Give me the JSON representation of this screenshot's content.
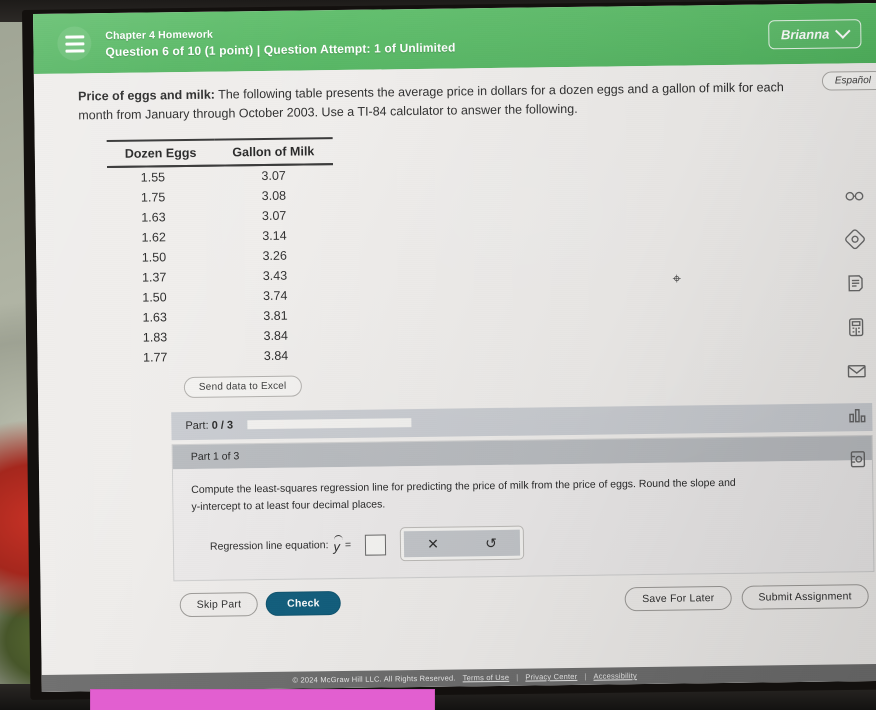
{
  "header": {
    "menu_icon": "hamburger-menu-icon",
    "assignment_title": "Chapter 4 Homework",
    "question_status": "Question 6 of 10 (1 point)  |  Question Attempt: 1 of Unlimited",
    "user_name": "Brianna",
    "user_chevron_icon": "chevron-down-icon",
    "brand_green": "#55b862"
  },
  "language_toggle": {
    "label": "Español"
  },
  "prompt": {
    "bold_lead": "Price of eggs and milk:",
    "rest": " The following table presents the average price in dollars for a dozen eggs and a gallon of milk for each month from January through October 2003. Use a TI-84 calculator to answer the following."
  },
  "table": {
    "columns": [
      "Dozen Eggs",
      "Gallon of Milk"
    ],
    "rows": [
      [
        "1.55",
        "3.07"
      ],
      [
        "1.75",
        "3.08"
      ],
      [
        "1.63",
        "3.07"
      ],
      [
        "1.62",
        "3.14"
      ],
      [
        "1.50",
        "3.26"
      ],
      [
        "1.37",
        "3.43"
      ],
      [
        "1.50",
        "3.74"
      ],
      [
        "1.63",
        "3.81"
      ],
      [
        "1.83",
        "3.84"
      ],
      [
        "1.77",
        "3.84"
      ]
    ]
  },
  "excel_button": {
    "label": "Send data to Excel"
  },
  "part_progress": {
    "label_prefix": "Part:",
    "score": "0 / 3",
    "progress_percent": 0
  },
  "part_card": {
    "header": "Part 1 of 3",
    "question_line1": "Compute the least-squares regression line for predicting the price of milk from the price of eggs. Round the slope and",
    "question_line2": "y-intercept to at least four decimal places.",
    "equation_label": "Regression line equation:",
    "equation_symbol": "y",
    "equation_operator": "=",
    "answer_value": "",
    "math_tools": [
      {
        "name": "clear-button",
        "glyph": "✕"
      },
      {
        "name": "undo-button",
        "glyph": "↺"
      }
    ]
  },
  "actions": {
    "skip_part": "Skip Part",
    "check": "Check",
    "save_for_later": "Save For Later",
    "submit_assignment": "Submit Assignment",
    "check_color": "#115e7d"
  },
  "rail_icons": [
    {
      "name": "glasses-icon"
    },
    {
      "name": "compass-help-icon"
    },
    {
      "name": "notes-document-icon"
    },
    {
      "name": "calculator-icon"
    },
    {
      "name": "mail-envelope-icon"
    },
    {
      "name": "bar-chart-icon"
    },
    {
      "name": "reference-sheet-icon"
    }
  ],
  "footer": {
    "copyright": "© 2024 McGraw Hill LLC. All Rights Reserved.",
    "terms": "Terms of Use",
    "privacy": "Privacy Center",
    "accessibility": "Accessibility",
    "sep": "|"
  }
}
